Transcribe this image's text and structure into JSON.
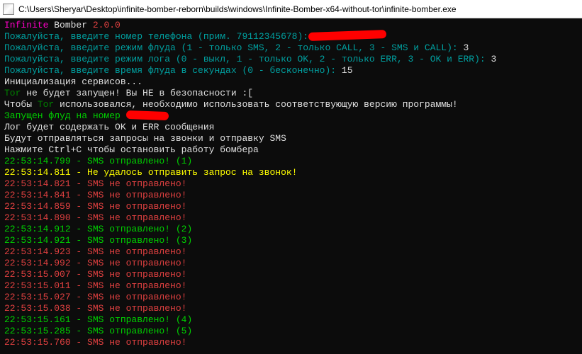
{
  "titlebar": {
    "path": "C:\\Users\\Sheryar\\Desktop\\infinite-bomber-reborn\\builds\\windows\\Infinite-Bomber-x64-without-tor\\infinite-bomber.exe"
  },
  "banner": {
    "name_colored": "Infinite",
    "name_rest": " Bomber ",
    "version": "2.0.0"
  },
  "prompts": {
    "phone": "Пожалуйста, введите номер телефона (прим. 79112345678):",
    "flood_mode": "Пожалуйста, введите режим флуда (1 - только SMS, 2 - только CALL, 3 - SMS и CALL): ",
    "flood_mode_val": "3",
    "log_mode": "Пожалуйста, введите режим лога (0 - выкл, 1 - только OK, 2 - только ERR, 3 - OK и ERR): ",
    "log_mode_val": "3",
    "flood_time": "Пожалуйста, введите время флуда в секундах (0 - бесконечно): ",
    "flood_time_val": "15"
  },
  "init": {
    "services": "Инициализация сервисов...",
    "tor_prefix": "Tor",
    "tor_rest": " не будет запущен! Вы НЕ в безопасности :[",
    "tor_hint_pre": "Чтобы ",
    "tor_word": "Tor",
    "tor_hint_post": " использовался, необходимо использовать соответствующую версию программы!",
    "started": "Запущен флуд на номер ",
    "log_note": "Лог будет содержать OK и ERR сообщения",
    "send_note": "Будут отправляться запросы на звонки и отправку SMS",
    "ctrlc": "Нажмите Ctrl+C чтобы остановить работу бомбера"
  },
  "logs": [
    {
      "t": "22:53:14.799",
      "s": "ok",
      "m": "SMS отправлено! (1)"
    },
    {
      "t": "22:53:14.811",
      "s": "yellow",
      "m": "Не удалось отправить запрос на звонок!"
    },
    {
      "t": "22:53:14.821",
      "s": "err",
      "m": "SMS не отправлено!"
    },
    {
      "t": "22:53:14.841",
      "s": "err",
      "m": "SMS не отправлено!"
    },
    {
      "t": "22:53:14.859",
      "s": "err",
      "m": "SMS не отправлено!"
    },
    {
      "t": "22:53:14.890",
      "s": "err",
      "m": "SMS не отправлено!"
    },
    {
      "t": "22:53:14.912",
      "s": "ok",
      "m": "SMS отправлено! (2)"
    },
    {
      "t": "22:53:14.921",
      "s": "ok",
      "m": "SMS отправлено! (3)"
    },
    {
      "t": "22:53:14.923",
      "s": "err",
      "m": "SMS не отправлено!"
    },
    {
      "t": "22:53:14.992",
      "s": "err",
      "m": "SMS не отправлено!"
    },
    {
      "t": "22:53:15.007",
      "s": "err",
      "m": "SMS не отправлено!"
    },
    {
      "t": "22:53:15.011",
      "s": "err",
      "m": "SMS не отправлено!"
    },
    {
      "t": "22:53:15.027",
      "s": "err",
      "m": "SMS не отправлено!"
    },
    {
      "t": "22:53:15.038",
      "s": "err",
      "m": "SMS не отправлено!"
    },
    {
      "t": "22:53:15.161",
      "s": "ok",
      "m": "SMS отправлено! (4)"
    },
    {
      "t": "22:53:15.285",
      "s": "ok",
      "m": "SMS отправлено! (5)"
    },
    {
      "t": "22:53:15.760",
      "s": "err",
      "m": "SMS не отправлено!"
    }
  ],
  "colors": {
    "ok": "#00d000",
    "err": "#e04040",
    "yellow": "#ffff00"
  }
}
